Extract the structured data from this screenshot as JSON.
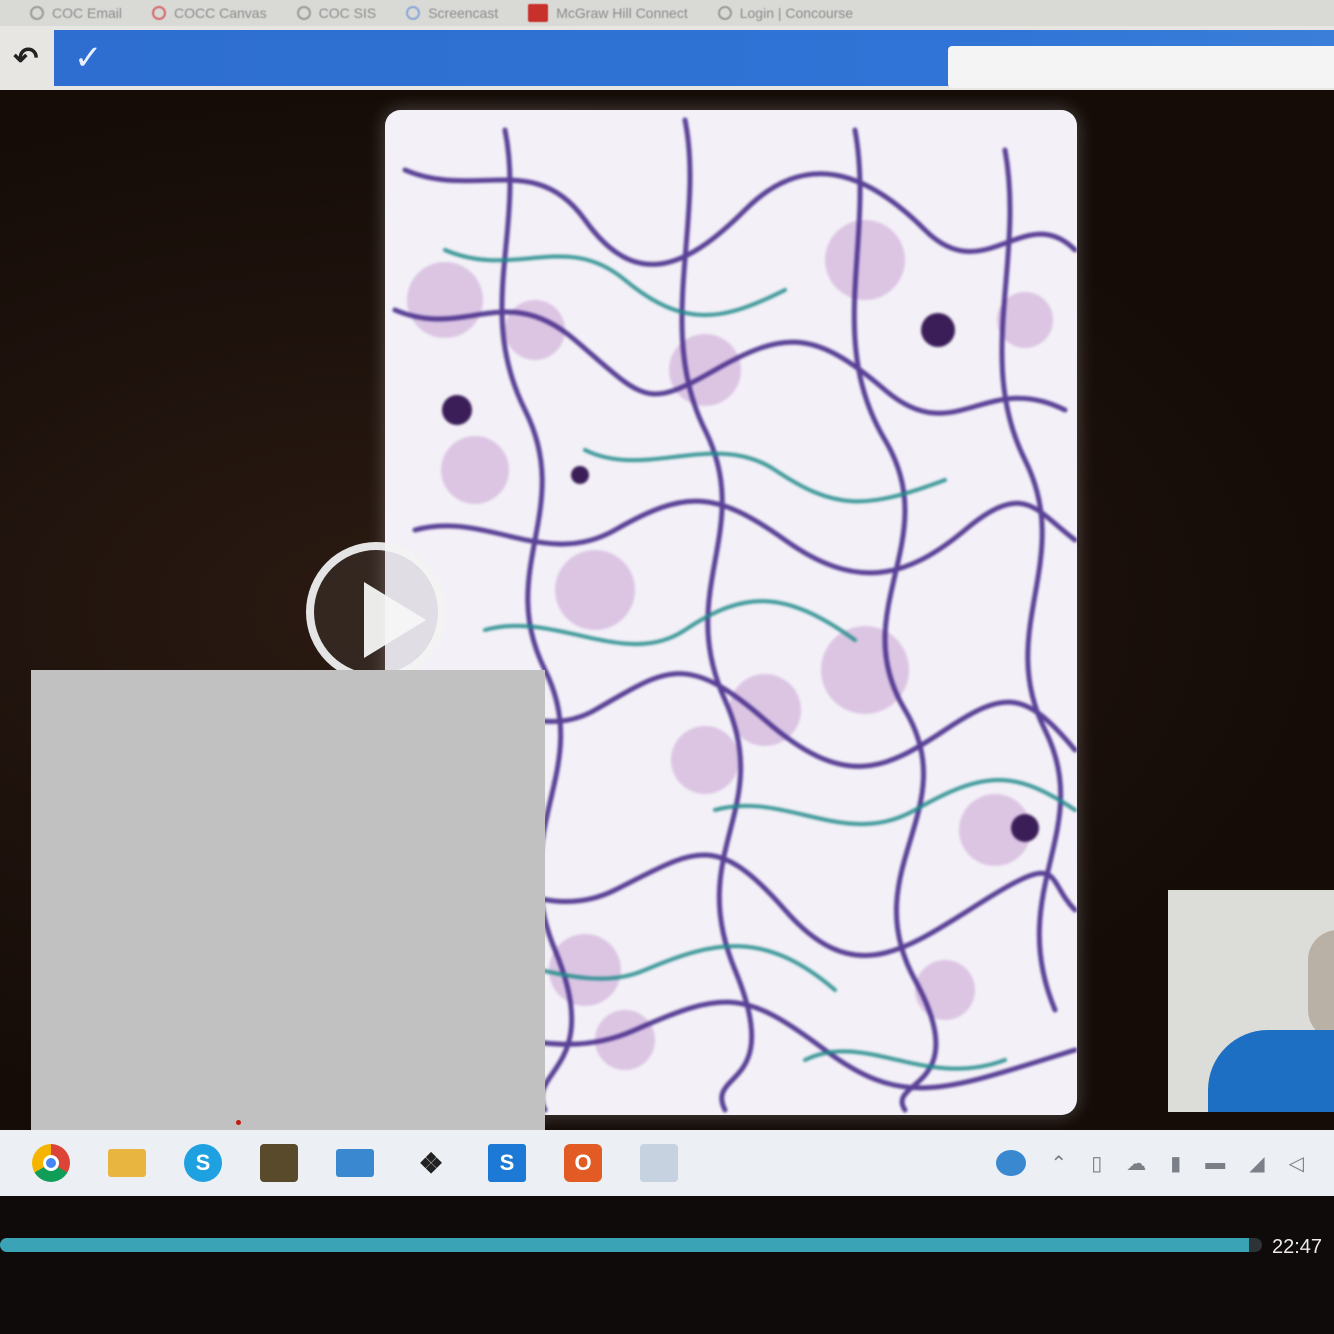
{
  "bookmarks": [
    {
      "label": "COC Email",
      "icon": "globe-icon"
    },
    {
      "label": "COCC Canvas",
      "icon": "canvas-icon"
    },
    {
      "label": "COC SIS",
      "icon": "globe-icon"
    },
    {
      "label": "Screencast",
      "icon": "screencast-icon"
    },
    {
      "label": "McGraw Hill Connect",
      "icon": "mcgraw-hill-icon"
    },
    {
      "label": "Login | Concourse",
      "icon": "concourse-icon"
    }
  ],
  "toolbar": {
    "back_icon": "↶",
    "check_icon": "✓",
    "url_value": ""
  },
  "player": {
    "play_icon": "play-icon",
    "progress": 0.99,
    "time": "22:47"
  },
  "taskbar": {
    "apps": [
      "chrome-icon",
      "file-explorer-icon",
      "skype-icon",
      "store-lock-icon",
      "mail-icon",
      "dropbox-icon",
      "sway-icon",
      "office-icon",
      "app-icon"
    ],
    "tray": [
      "help-icon",
      "chevron-up-icon",
      "usb-icon",
      "cloud-icon",
      "microphone-icon",
      "battery-icon",
      "wifi-icon",
      "volume-icon"
    ]
  },
  "colors": {
    "browser_bar": "#2f74d6",
    "progress": "#3aa3b5",
    "redaction": "#c1c1c1"
  }
}
